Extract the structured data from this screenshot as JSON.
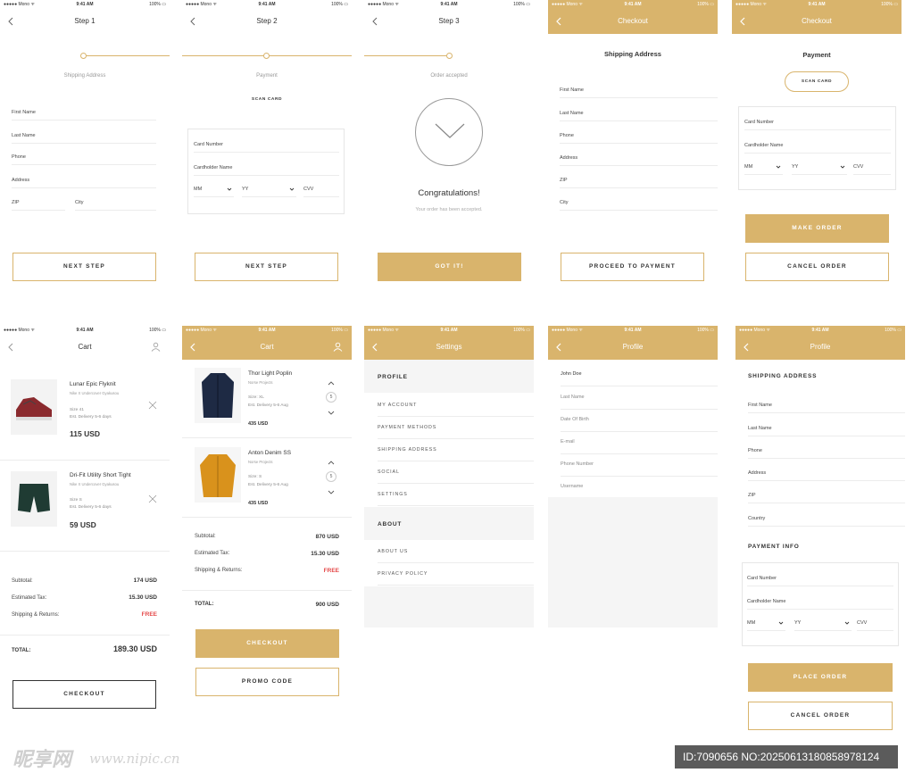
{
  "status_bar": {
    "carrier": "●●●●● Mono ᯤ",
    "time": "9:41 AM",
    "battery": "100% ▭"
  },
  "step1": {
    "nav_title": "Step 1",
    "step_label": "Shipping Address",
    "fields": [
      "First Name",
      "Last Name",
      "Phone",
      "Address"
    ],
    "zip": "ZIP",
    "city": "City",
    "button": "NEXT STEP"
  },
  "step2": {
    "nav_title": "Step 2",
    "step_label": "Payment",
    "scan_card": "SCAN CARD",
    "card_number": "Card Number",
    "cardholder": "Cardholder Name",
    "month": "MM",
    "year": "YY",
    "cvv": "CVV",
    "button": "NEXT STEP"
  },
  "step3": {
    "nav_title": "Step 3",
    "step_label": "Order accepted",
    "heading": "Congratulations!",
    "subtext": "Your order has been accepted.",
    "button": "GOT IT!"
  },
  "checkout_shipping": {
    "nav_title": "Checkout",
    "section": "Shipping Address",
    "fields": [
      "First Name",
      "Last Name",
      "Phone",
      "Address",
      "ZIP",
      "City"
    ],
    "button": "PROCEED TO PAYMENT"
  },
  "checkout_payment": {
    "nav_title": "Checkout",
    "section": "Payment",
    "scan_card": "SCAN CARD",
    "card_number": "Card Number",
    "cardholder": "Cardholder Name",
    "month": "MM",
    "year": "YY",
    "cvv": "CVV",
    "primary_button": "MAKE ORDER",
    "secondary_button": "CANCEL ORDER"
  },
  "cart1": {
    "nav_title": "Cart",
    "items": [
      {
        "name": "Lunar Epic Flyknit",
        "brand": "Nike X Undercover Gyakusou",
        "size": "Size 41",
        "delivery": "Est. Delivery 5-6 days",
        "price": "115 USD"
      },
      {
        "name": "Dri-Fit Utility Short Tight",
        "brand": "Nike X Undercover Gyakusou",
        "size": "Size S",
        "delivery": "Est. Delivery 5-6 days",
        "price": "59 USD"
      }
    ],
    "subtotal_label": "Subtotal:",
    "subtotal": "174 USD",
    "tax_label": "Estimated Tax:",
    "tax": "15.30 USD",
    "shipping_label": "Shipping & Returns:",
    "shipping": "FREE",
    "total_label": "TOTAL:",
    "total": "189.30 USD",
    "button": "CHECKOUT"
  },
  "cart2": {
    "nav_title": "Cart",
    "items": [
      {
        "name": "Thor Light Poplin",
        "brand": "Norse Projects",
        "size": "Size: XL",
        "delivery": "Est. Delivery 5-6 Aug",
        "price": "435 USD",
        "qty": "5"
      },
      {
        "name": "Anton Denim SS",
        "brand": "Norse Projects",
        "size": "Size: S",
        "delivery": "Est. Delivery 5-6 Aug",
        "price": "435 USD",
        "qty": "5"
      }
    ],
    "subtotal_label": "Subtotal:",
    "subtotal": "870 USD",
    "tax_label": "Estimated Tax:",
    "tax": "15.30 USD",
    "shipping_label": "Shipping & Returns:",
    "shipping": "FREE",
    "total_label": "TOTAL:",
    "total": "900 USD",
    "primary_button": "CHECKOUT",
    "secondary_button": "PROMO CODE"
  },
  "settings": {
    "nav_title": "Settings",
    "profile_header": "PROFILE",
    "profile_items": [
      "MY ACCOUNT",
      "PAYMENT METHODS",
      "SHIPPING ADDRESS",
      "SOCIAL",
      "SETTINGS"
    ],
    "about_header": "ABOUT",
    "about_items": [
      "ABOUT US",
      "PRIVACY POLICY"
    ]
  },
  "profile1": {
    "nav_title": "Profile",
    "fields": [
      "John Doe",
      "Last Name",
      "Date Of Birth",
      "E-mail",
      "Phone Number",
      "Username"
    ]
  },
  "profile2": {
    "nav_title": "Profile",
    "shipping_header": "SHIPPING ADDRESS",
    "fields": [
      "First Name",
      "Last Name",
      "Phone",
      "Address",
      "ZIP",
      "Country"
    ],
    "payment_header": "PAYMENT INFO",
    "card_number": "Card Number",
    "cardholder": "Cardholder Name",
    "month": "MM",
    "year": "YY",
    "cvv": "CVV",
    "primary_button": "PLACE ORDER",
    "secondary_button": "CANCEL ORDER"
  },
  "watermark": {
    "logo": "昵享网",
    "url": "www.nipic.cn",
    "id_text": "ID:7090656 NO:20250613180858978124"
  },
  "colors": {
    "accent": "#d9b46c",
    "free": "#e54b4b",
    "text": "#333333",
    "line": "#ececec"
  }
}
